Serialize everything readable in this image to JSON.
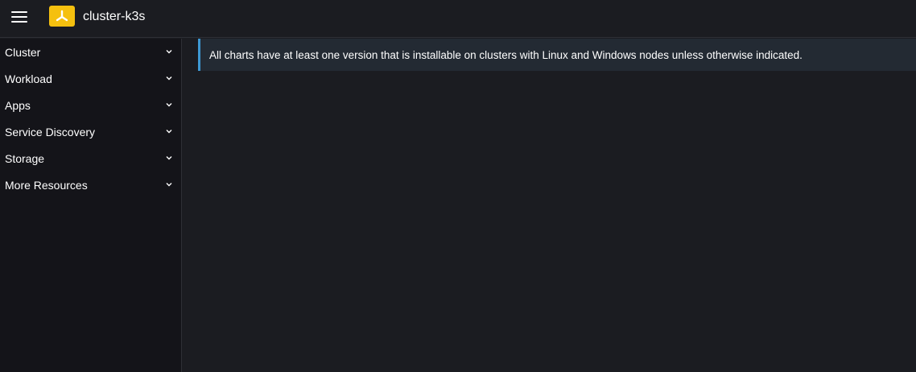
{
  "header": {
    "cluster_name": "cluster-k3s",
    "menu_icon": "hamburger-menu-icon",
    "logo_icon": "rancher-logo-icon",
    "logo_color": "#f5c00f"
  },
  "sidebar": {
    "items": [
      {
        "label": "Cluster",
        "icon": "chevron-down-icon"
      },
      {
        "label": "Workload",
        "icon": "chevron-down-icon"
      },
      {
        "label": "Apps",
        "icon": "chevron-down-icon"
      },
      {
        "label": "Service Discovery",
        "icon": "chevron-down-icon"
      },
      {
        "label": "Storage",
        "icon": "chevron-down-icon"
      },
      {
        "label": "More Resources",
        "icon": "chevron-down-icon"
      }
    ]
  },
  "main": {
    "banner_text": "All charts have at least one version that is installable on clusters with Linux and Windows nodes unless otherwise indicated.",
    "banner_accent": "#3d98d3"
  }
}
